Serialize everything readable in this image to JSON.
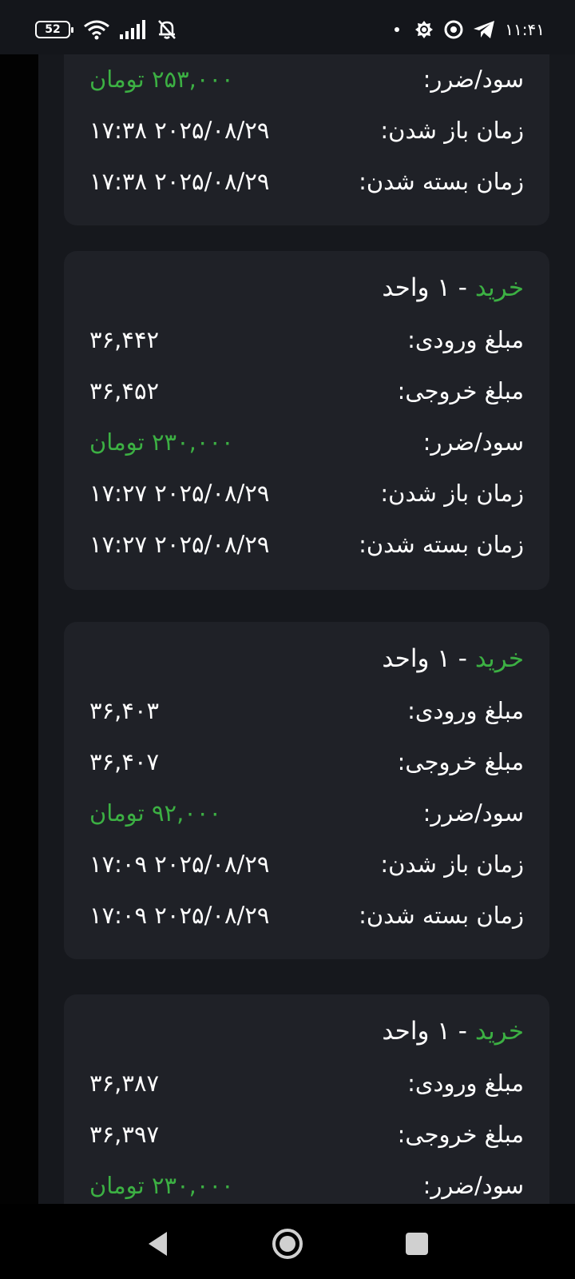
{
  "status_bar": {
    "battery": "52",
    "time": "۱۱:۴۱",
    "icons": [
      "battery-icon",
      "wifi-icon",
      "signal-icon",
      "bell-off-icon",
      "dot-icon",
      "shield-app-icon",
      "chrome-icon",
      "telegram-icon"
    ]
  },
  "colors": {
    "accent_green": "#3cb043",
    "card_bg": "#1f2127",
    "page_bg": "#16181d"
  },
  "cards": [
    {
      "rows": [
        {
          "label": "سود/ضرر:",
          "value": "۲۵۳,۰۰۰ تومان",
          "green": true
        },
        {
          "label": "زمان باز شدن:",
          "value": "۲۰۲۵/۰۸/۲۹ ۱۷:۳۸"
        },
        {
          "label": "زمان بسته شدن:",
          "value": "۲۰۲۵/۰۸/۲۹ ۱۷:۳۸"
        }
      ]
    },
    {
      "side": "خرید",
      "qty": " - ۱ واحد",
      "rows": [
        {
          "label": "مبلغ ورودی:",
          "value": "۳۶,۴۴۲"
        },
        {
          "label": "مبلغ خروجی:",
          "value": "۳۶,۴۵۲"
        },
        {
          "label": "سود/ضرر:",
          "value": "۲۳۰,۰۰۰ تومان",
          "green": true
        },
        {
          "label": "زمان باز شدن:",
          "value": "۲۰۲۵/۰۸/۲۹ ۱۷:۲۷"
        },
        {
          "label": "زمان بسته شدن:",
          "value": "۲۰۲۵/۰۸/۲۹ ۱۷:۲۷"
        }
      ]
    },
    {
      "side": "خرید",
      "qty": " - ۱ واحد",
      "rows": [
        {
          "label": "مبلغ ورودی:",
          "value": "۳۶,۴۰۳"
        },
        {
          "label": "مبلغ خروجی:",
          "value": "۳۶,۴۰۷"
        },
        {
          "label": "سود/ضرر:",
          "value": "۹۲,۰۰۰ تومان",
          "green": true
        },
        {
          "label": "زمان باز شدن:",
          "value": "۲۰۲۵/۰۸/۲۹ ۱۷:۰۹"
        },
        {
          "label": "زمان بسته شدن:",
          "value": "۲۰۲۵/۰۸/۲۹ ۱۷:۰۹"
        }
      ]
    },
    {
      "side": "خرید",
      "qty": " - ۱ واحد",
      "rows": [
        {
          "label": "مبلغ ورودی:",
          "value": "۳۶,۳۸۷"
        },
        {
          "label": "مبلغ خروجی:",
          "value": "۳۶,۳۹۷"
        },
        {
          "label": "سود/ضرر:",
          "value": "۲۳۰,۰۰۰ تومان",
          "green": true
        }
      ]
    }
  ],
  "nav": [
    "back-icon",
    "home-icon",
    "recents-icon"
  ]
}
